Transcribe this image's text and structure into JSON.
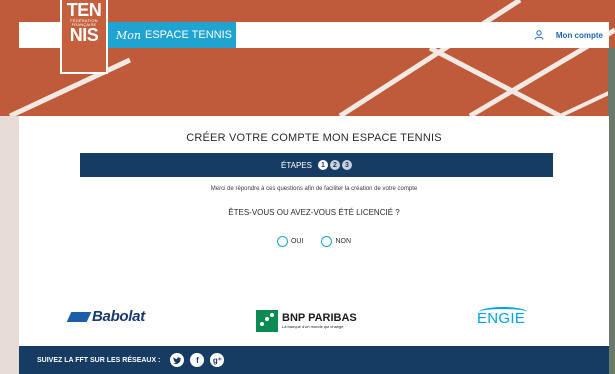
{
  "header": {
    "logo_top": "TEN",
    "logo_small": "FÉDÉRATION FRANÇAISE",
    "logo_bottom": "NIS",
    "brand_script": "Mon",
    "brand_text": "ESPACE TENNIS",
    "account_label": "Mon compte"
  },
  "form": {
    "title": "CRÉER VOTRE COMPTE MON ESPACE TENNIS",
    "steps_label": "ÉTAPES",
    "steps": [
      "1",
      "2",
      "3"
    ],
    "active_step": 1,
    "help_text": "Merci de répondre à ces questions afin de faciliter la création de votre compte",
    "question": "ÊTES-VOUS OU AVEZ-VOUS ÉTÉ LICENCIÉ ?",
    "option_yes": "OUI",
    "option_no": "NON"
  },
  "sponsors": {
    "babolat": "Babolat",
    "bnp_name": "BNP PARIBAS",
    "bnp_tagline": "La banque d'un monde qui change",
    "engie": "ENGIE"
  },
  "footer": {
    "social_label": "SUIVEZ LA FFT SUR LES RÉSEAUX :",
    "icons": [
      "twitter-icon",
      "facebook-icon",
      "google-plus-icon"
    ]
  },
  "colors": {
    "clay": "#c4603d",
    "brand_blue": "#1fa3d0",
    "navy": "#173c63"
  }
}
